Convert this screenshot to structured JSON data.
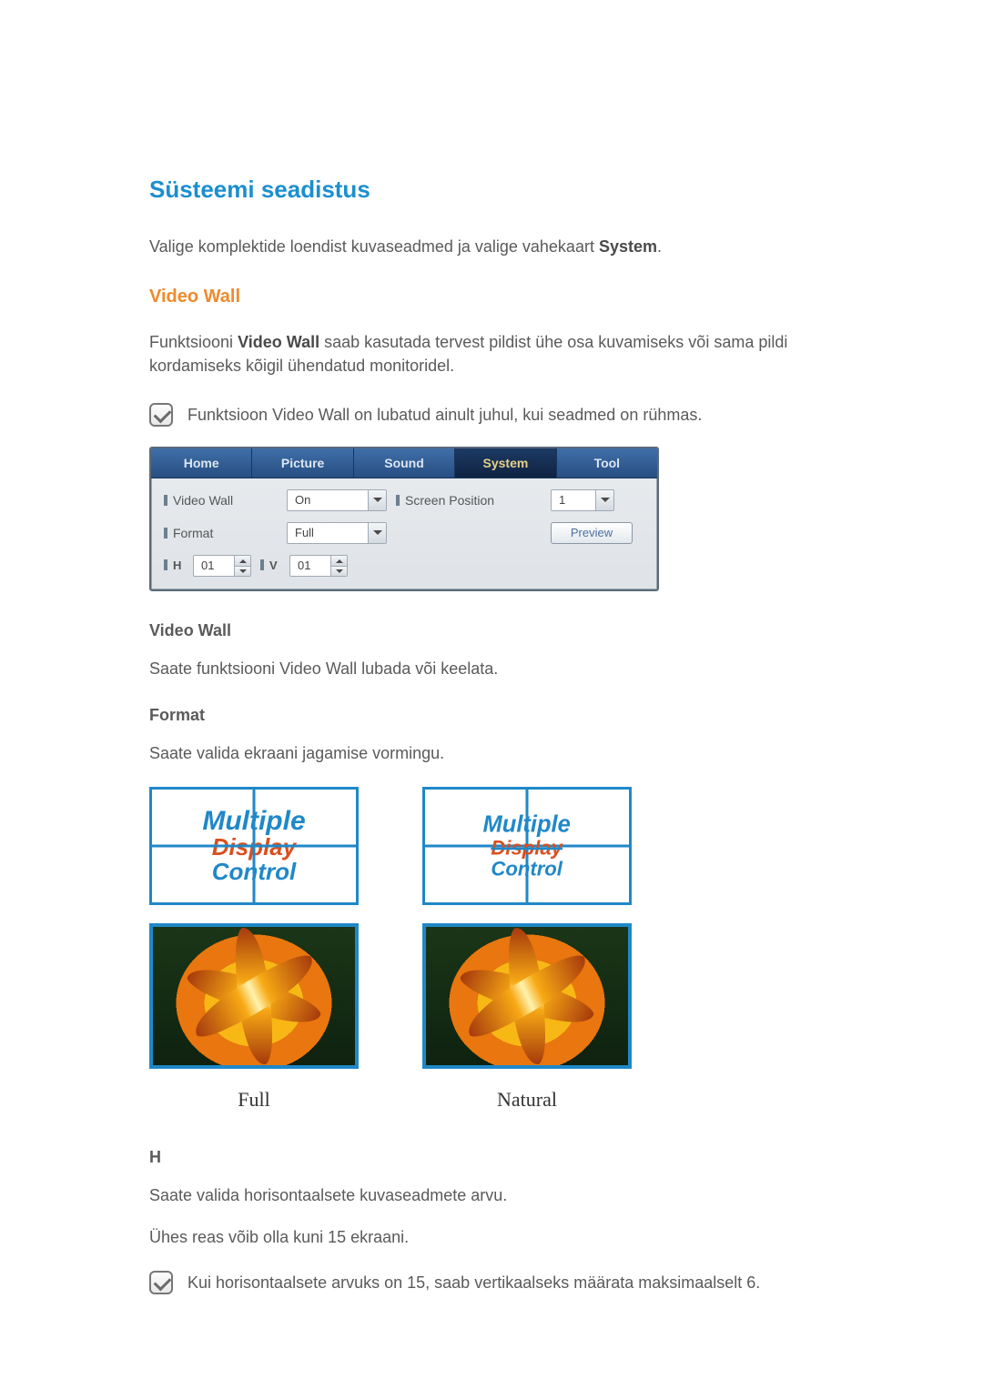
{
  "heading": "Süsteemi seadistus",
  "intro": {
    "pre": "Valige komplektide loendist kuvaseadmed ja valige vahekaart ",
    "bold": "System",
    "post": "."
  },
  "vw_heading": "Video Wall",
  "vw_desc": {
    "pre": "Funktsiooni ",
    "bold": "Video Wall",
    "post": " saab kasutada tervest pildist ühe osa kuvamiseks või sama pildi kordamiseks kõigil ühendatud monitoridel."
  },
  "vw_note": {
    "pre": "Funktsioon ",
    "bold": "Video Wall",
    "post": " on lubatud ainult juhul, kui seadmed on rühmas."
  },
  "tabs": {
    "home": "Home",
    "picture": "Picture",
    "sound": "Sound",
    "system": "System",
    "tool": "Tool"
  },
  "panel": {
    "video_wall_label": "Video Wall",
    "video_wall_value": "On",
    "screen_position_label": "Screen Position",
    "screen_position_value": "1",
    "format_label": "Format",
    "format_value": "Full",
    "preview": "Preview",
    "h_label": "H",
    "h_value": "01",
    "v_label": "V",
    "v_value": "01"
  },
  "vw_sub_heading": "Video Wall",
  "vw_sub_text": {
    "pre": "Saate funktsiooni ",
    "bold": "Video Wall",
    "post": " lubada või keelata."
  },
  "format_heading": "Format",
  "format_text": "Saate valida ekraani jagamise vormingu.",
  "mdc": {
    "l1": "Multiple",
    "l2": "Display",
    "l3": "Control"
  },
  "caption_full": "Full",
  "caption_natural": "Natural",
  "h_heading": "H",
  "h_text1": "Saate valida horisontaalsete kuvaseadmete arvu.",
  "h_text2": "Ühes reas võib olla kuni 15 ekraani.",
  "h_note": "Kui horisontaalsete arvuks on 15, saab vertikaalseks määrata maksimaalselt 6."
}
